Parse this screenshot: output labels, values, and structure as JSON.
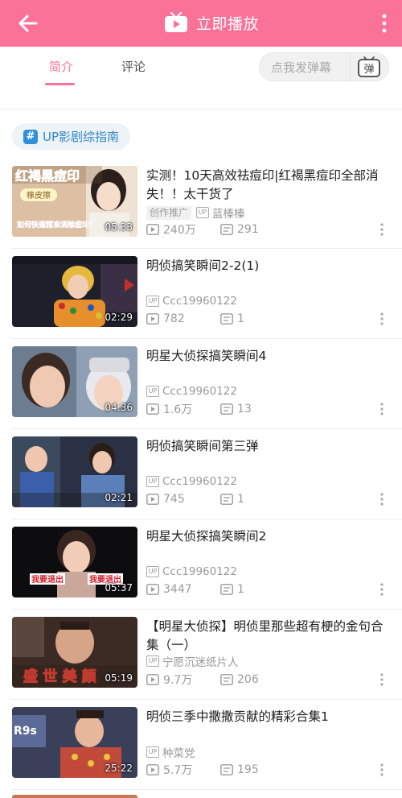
{
  "topbar": {
    "back_icon": "back-arrow-icon",
    "play_label": "立即播放",
    "more_icon": "more-vert-icon",
    "background": "#fb7299"
  },
  "tabs": [
    {
      "label": "简介",
      "active": true
    },
    {
      "label": "评论",
      "active": false
    }
  ],
  "danmaku": {
    "placeholder": "点我发弹幕",
    "toggle_label": "弹"
  },
  "channel_chip": {
    "label": "UP影剧综指南",
    "icon": "hash-icon"
  },
  "videos": [
    {
      "title": "实测！10天高效祛痘印|红褐黑痘印全部消失！！太干货了",
      "promo": "创作推广",
      "up": "蓝榛榛",
      "views": "240万",
      "danmaku": "291",
      "duration": "05:33"
    },
    {
      "title": "明侦搞笑瞬间2-2(1)",
      "up": "Ccc19960122",
      "views": "782",
      "danmaku": "1",
      "duration": "02:29"
    },
    {
      "title": "明星大侦探搞笑瞬间4",
      "up": "Ccc19960122",
      "views": "1.6万",
      "danmaku": "13",
      "duration": "04:36"
    },
    {
      "title": "明侦搞笑瞬间第三弹",
      "up": "Ccc19960122",
      "views": "745",
      "danmaku": "1",
      "duration": "02:21"
    },
    {
      "title": "明星大侦探搞笑瞬间2",
      "up": "Ccc19960122",
      "views": "3447",
      "danmaku": "1",
      "duration": "05:37"
    },
    {
      "title": "【明星大侦探】明侦里那些超有梗的金句合集（一）",
      "up": "宁愿沉迷纸片人",
      "views": "9.7万",
      "danmaku": "206",
      "duration": "05:19"
    },
    {
      "title": "明侦三季中撒撒贡献的精彩合集1",
      "up": "种菜党",
      "views": "5.7万",
      "danmaku": "195",
      "duration": "25:22"
    }
  ],
  "thumb_overlays": {
    "v1_top": "红褐黑痘印",
    "v1_tag": "橡皮擦",
    "v1_caption": "如何快速精准消除痘印？",
    "v5_caption_left": "我要退出",
    "v5_caption_right": "我要退出",
    "v6_caption": "盛 世 美 颜",
    "v7_corner": "R9s"
  },
  "up_badge": "UP",
  "icons": {
    "views": "play-count-icon",
    "danmaku": "danmaku-count-icon",
    "kebab": "more-vert-icon"
  }
}
